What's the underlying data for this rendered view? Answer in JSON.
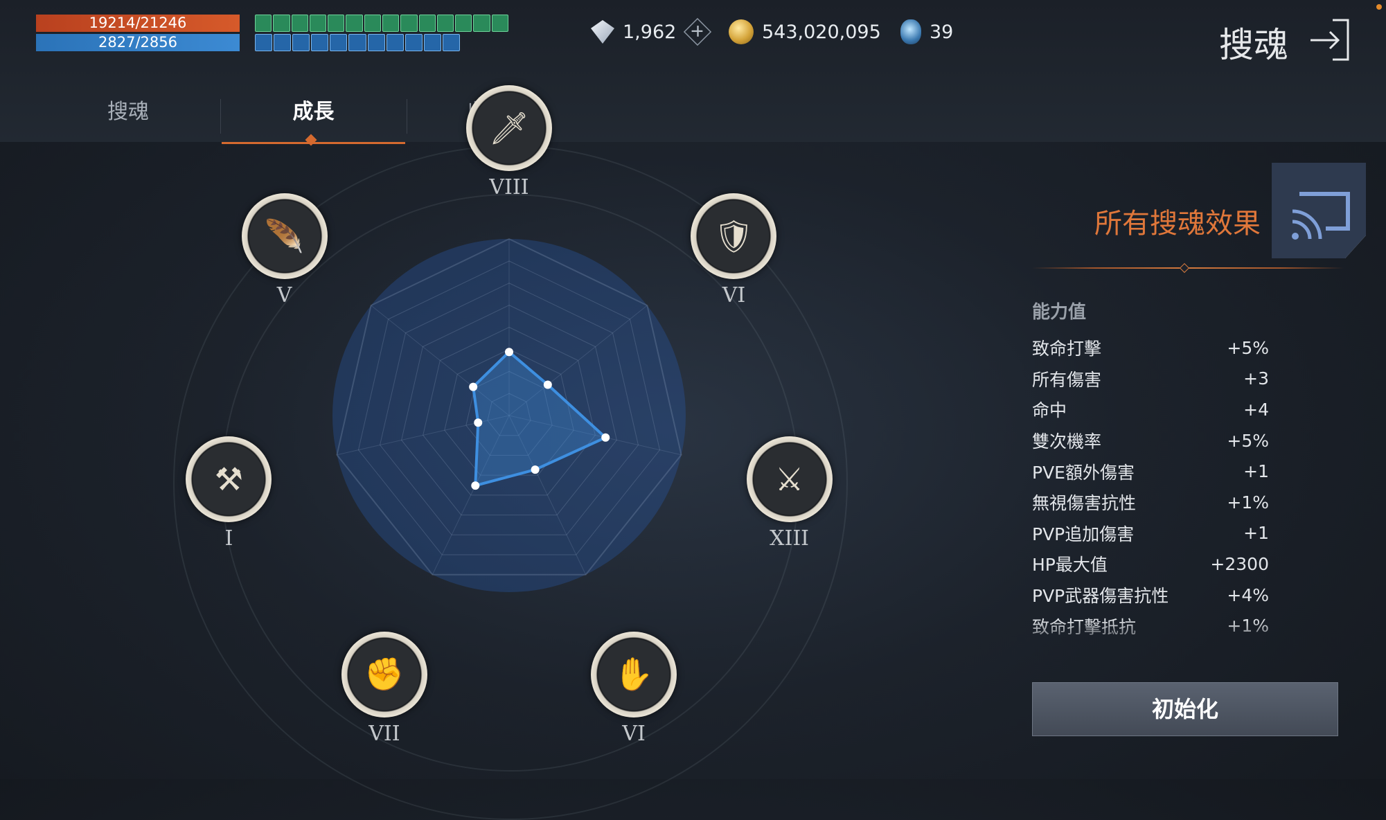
{
  "status": {
    "hp": "19214/21246",
    "mp": "2827/2856"
  },
  "currency": {
    "gems": "1,962",
    "gold": "543,020,095",
    "crystals": "39"
  },
  "header": {
    "title": "搜魂"
  },
  "tabs": [
    {
      "label": "搜魂",
      "active": false
    },
    {
      "label": "成長",
      "active": true
    },
    {
      "label": "收藏品",
      "active": false
    }
  ],
  "graph": {
    "nodes": [
      {
        "numeral": "VIII",
        "icon": "sword-icon"
      },
      {
        "numeral": "VI",
        "icon": "shield-crest-icon"
      },
      {
        "numeral": "XIII",
        "icon": "book-swords-icon"
      },
      {
        "numeral": "VI",
        "icon": "hands-icon"
      },
      {
        "numeral": "VII",
        "icon": "fist-icon"
      },
      {
        "numeral": "I",
        "icon": "axes-icon"
      },
      {
        "numeral": "V",
        "icon": "feather-icon"
      }
    ],
    "values": [
      0.36,
      0.28,
      0.56,
      0.34,
      0.44,
      0.18,
      0.26
    ],
    "accent": "#3e8fe0"
  },
  "panel": {
    "title": "所有搜魂效果",
    "section_label": "能力值",
    "stats": [
      {
        "name": "致命打擊",
        "value": "+5%"
      },
      {
        "name": "所有傷害",
        "value": "+3"
      },
      {
        "name": "命中",
        "value": "+4"
      },
      {
        "name": "雙次機率",
        "value": "+5%"
      },
      {
        "name": "PVE額外傷害",
        "value": "+1"
      },
      {
        "name": "無視傷害抗性",
        "value": "+1%"
      },
      {
        "name": "PVP追加傷害",
        "value": "+1"
      },
      {
        "name": "HP最大值",
        "value": "+2300"
      },
      {
        "name": "PVP武器傷害抗性",
        "value": "+4%"
      },
      {
        "name": "致命打擊抵抗",
        "value": "+1%"
      }
    ],
    "reset_label": "初始化"
  }
}
